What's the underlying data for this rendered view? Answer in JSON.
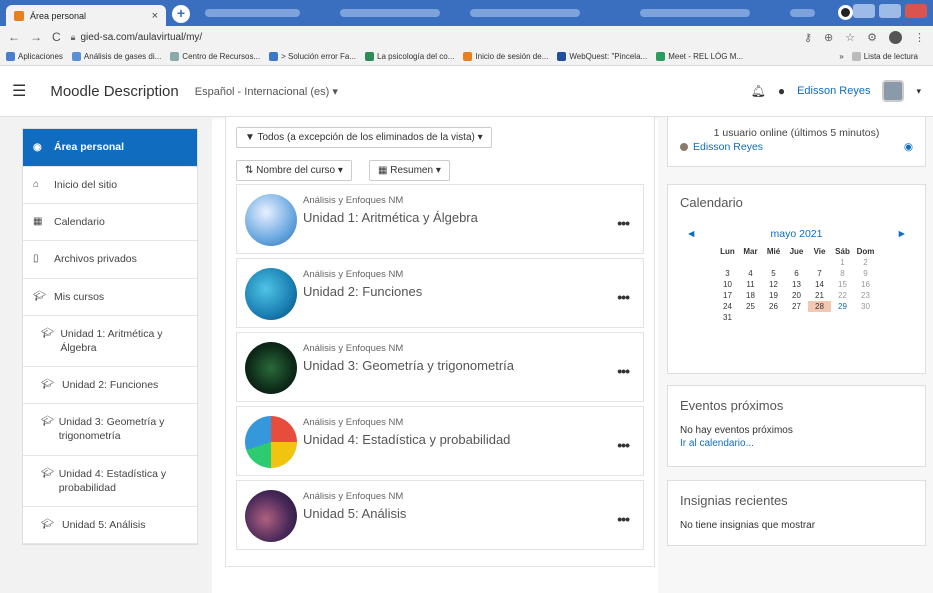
{
  "browser": {
    "tab_title": "Área personal",
    "url": "gied-sa.com/aulavirtual/my/",
    "bookmarks": [
      "Aplicaciones",
      "Análisis de gases di...",
      "Centro de Recursos...",
      "> Solución error Fa...",
      "La psicología del co...",
      "Inicio de sesión de...",
      "WebQuest: \"Pincela...",
      "Meet - REL LÓG M..."
    ],
    "bookmarks_more": "»",
    "reading_list": "Lista de lectura"
  },
  "navbar": {
    "site_name": "Moodle Description",
    "language": "Español - Internacional (es)",
    "user_name": "Edisson Reyes"
  },
  "drawer": {
    "items": [
      {
        "label": "Área personal",
        "icon": "dashboard-icon",
        "active": true
      },
      {
        "label": "Inicio del sitio",
        "icon": "home-icon"
      },
      {
        "label": "Calendario",
        "icon": "calendar-icon"
      },
      {
        "label": "Archivos privados",
        "icon": "file-icon"
      },
      {
        "label": "Mis cursos",
        "icon": "graduation-cap-icon"
      },
      {
        "label": "Unidad 1: Aritmética y Álgebra",
        "icon": "graduation-cap-icon",
        "sub": true
      },
      {
        "label": "Unidad 2: Funciones",
        "icon": "graduation-cap-icon",
        "sub": true
      },
      {
        "label": "Unidad 3: Geometría y trigonometría",
        "icon": "graduation-cap-icon",
        "sub": true
      },
      {
        "label": "Unidad 4: Estadística y probabilidad",
        "icon": "graduation-cap-icon",
        "sub": true
      },
      {
        "label": "Unidad 5: Análisis",
        "icon": "graduation-cap-icon",
        "sub": true
      }
    ]
  },
  "main": {
    "filter_label": "Todos (a excepción de los eliminados de la vista)",
    "sort_label": "Nombre del curso",
    "view_label": "Resumen",
    "courses": [
      {
        "category": "Análisis y Enfoques NM",
        "name": "Unidad 1: Aritmética y Álgebra"
      },
      {
        "category": "Análisis y Enfoques NM",
        "name": "Unidad 2: Funciones"
      },
      {
        "category": "Análisis y Enfoques NM",
        "name": "Unidad 3: Geometría y trigonometría"
      },
      {
        "category": "Análisis y Enfoques NM",
        "name": "Unidad 4: Estadística y probabilidad"
      },
      {
        "category": "Análisis y Enfoques NM",
        "name": "Unidad 5: Análisis"
      }
    ],
    "more_label": "•••"
  },
  "online_block": {
    "text": "1 usuario online (últimos 5 minutos)",
    "user": "Edisson Reyes"
  },
  "calendar": {
    "title": "Calendario",
    "month": "mayo 2021",
    "prev": "◄",
    "next": "►",
    "weekdays": [
      "Lun",
      "Mar",
      "Mié",
      "Jue",
      "Vie",
      "Sáb",
      "Dom"
    ],
    "weeks": [
      [
        "",
        "",
        "",
        "",
        "",
        "1",
        "2"
      ],
      [
        "3",
        "4",
        "5",
        "6",
        "7",
        "8",
        "9"
      ],
      [
        "10",
        "11",
        "12",
        "13",
        "14",
        "15",
        "16"
      ],
      [
        "17",
        "18",
        "19",
        "20",
        "21",
        "22",
        "23"
      ],
      [
        "24",
        "25",
        "26",
        "27",
        "28",
        "29",
        "30"
      ],
      [
        "31",
        "",
        "",
        "",
        "",
        "",
        ""
      ]
    ],
    "today": "28"
  },
  "events": {
    "title": "Eventos próximos",
    "empty": "No hay eventos próximos",
    "link": "Ir al calendario..."
  },
  "badges": {
    "title": "Insignias recientes",
    "empty": "No tiene insignias que mostrar"
  },
  "colors": {
    "brand_blue": "#0f6cbf",
    "chrome_blue": "#3a6fc0",
    "today": "#f2c8b2"
  }
}
